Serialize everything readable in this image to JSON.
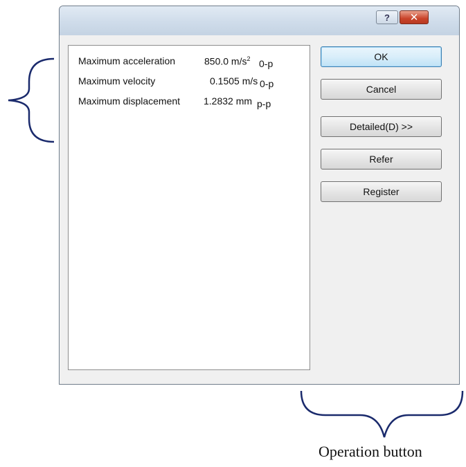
{
  "titlebar": {
    "help_label": "?",
    "close_label": "✕"
  },
  "results": [
    {
      "label": "Maximum acceleration",
      "value": "850.0 m/s",
      "superscript": "2",
      "suffix": "0-p"
    },
    {
      "label": "Maximum velocity",
      "value": "0.1505 m/s",
      "superscript": "",
      "suffix": "0-p"
    },
    {
      "label": "Maximum displacement",
      "value": "1.2832 mm",
      "superscript": "",
      "suffix": "p-p"
    }
  ],
  "buttons": {
    "ok": "OK",
    "cancel": "Cancel",
    "detailed": "Detailed(D) >>",
    "refer": "Refer",
    "register": "Register"
  },
  "annotation": {
    "caption": "Operation button",
    "brace_color": "#1a2a6c"
  },
  "colors": {
    "dialog_bg": "#f0f0f0",
    "titlebar": "#cfdcea",
    "close": "#c9442a",
    "default_button": "#bfe2f6"
  }
}
